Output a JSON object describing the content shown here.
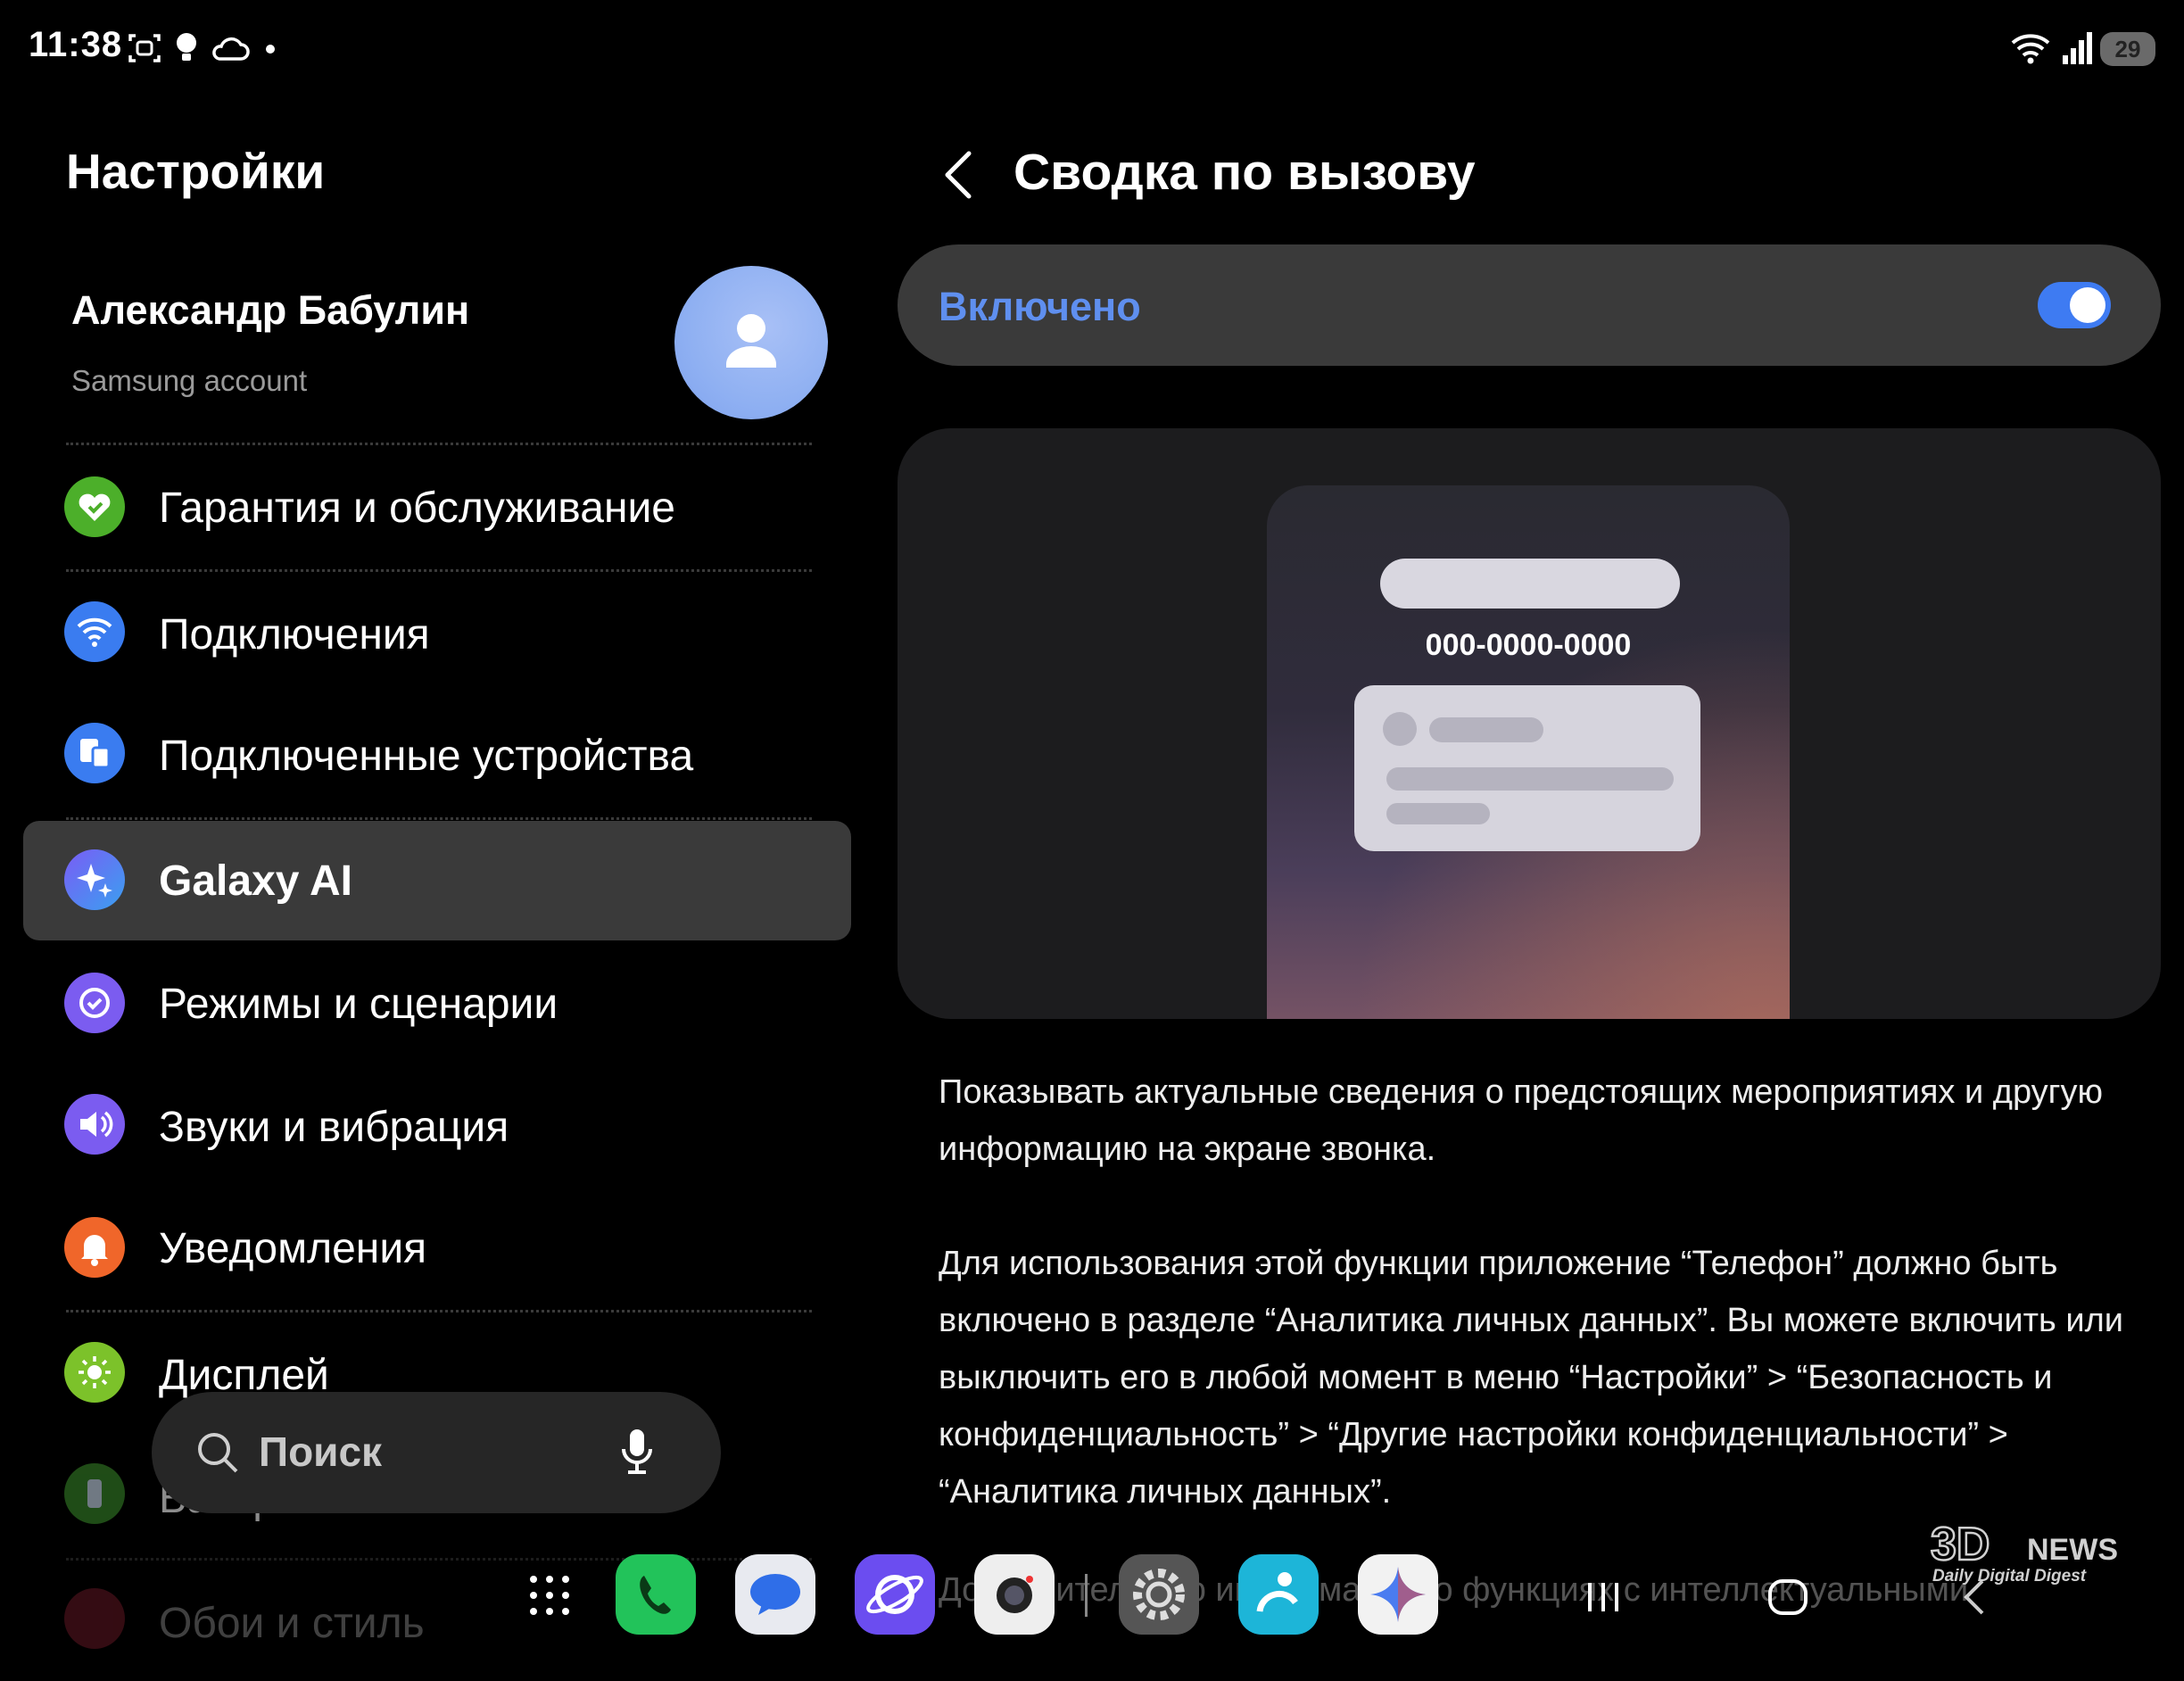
{
  "status_bar": {
    "time": "11:38",
    "left_icons": [
      "screenshot-icon",
      "bulb-icon",
      "cloud-icon",
      "dot-icon"
    ],
    "right_icons": [
      "wifi-icon",
      "signal-icon",
      "battery-icon"
    ],
    "battery_level": "29"
  },
  "sidebar": {
    "title": "Настройки",
    "account": {
      "name": "Александр Бабулин",
      "subtitle": "Samsung account",
      "icon": "person-icon"
    },
    "items": [
      {
        "label": "Гарантия и обслуживание",
        "icon": "heart-icon",
        "color": "#4caf2a"
      },
      {
        "label": "Подключения",
        "icon": "wifi-icon",
        "color": "#3a7cf0"
      },
      {
        "label": "Подключенные устройства",
        "icon": "devices-icon",
        "color": "#3a7cf0"
      },
      {
        "label": "Galaxy AI",
        "icon": "sparkle-icon",
        "color": "#4d6af5",
        "active": true
      },
      {
        "label": "Режимы и сценарии",
        "icon": "check-circle-icon",
        "color": "#7b5cf0"
      },
      {
        "label": "Звуки и вибрация",
        "icon": "speaker-icon",
        "color": "#7b5cf0"
      },
      {
        "label": "Уведомления",
        "icon": "bell-icon",
        "color": "#f0662a"
      },
      {
        "label": "Дисплей",
        "icon": "sun-icon",
        "color": "#7cc22a"
      },
      {
        "label": "Батарея",
        "icon": "battery-icon",
        "color": "#3a8a2a"
      },
      {
        "label": "Обои и стиль",
        "icon": "wallpaper-icon",
        "color": "#d0304a"
      }
    ]
  },
  "search": {
    "label": "Поиск",
    "icons": [
      "search-icon",
      "mic-icon"
    ]
  },
  "detail": {
    "title": "Сводка по вызову",
    "toggle": {
      "label": "Включено",
      "state": "on",
      "accent": "#3e7bf2"
    },
    "preview": {
      "number": "000-0000-0000"
    },
    "paragraph1": "Показывать актуальные сведения о предстоящих мероприятиях и другую информацию на экране звонка.",
    "paragraph2": "Для использования этой функции приложение “Телефон” должно быть включено в разделе “Аналитика личных данных”. Вы можете включить или выключить его в любой момент в меню “Настройки” > “Безопасность и конфиденциальность” > “Другие настройки конфиденциальности” > “Аналитика личных данных”.",
    "paragraph3": "Дополнительную информацию о функциях с интеллектуальными"
  },
  "dock": {
    "apps": [
      {
        "name": "apps-grid-icon"
      },
      {
        "name": "phone-app-icon",
        "color": "#22c35a"
      },
      {
        "name": "messages-app-icon",
        "color": "#e8eaf0"
      },
      {
        "name": "internet-app-icon",
        "color": "#6b4df0"
      },
      {
        "name": "camera-app-icon",
        "color": "#eeeeee"
      },
      {
        "name": "settings-app-icon",
        "color": "#555555"
      },
      {
        "name": "bixby-app-icon",
        "color": "#1db5d8"
      },
      {
        "name": "gemini-app-icon",
        "color": "#f2f2f2"
      }
    ],
    "nav": [
      "recents-icon",
      "home-icon",
      "back-nav-icon"
    ]
  },
  "watermark": {
    "brand": "3DNEWS",
    "tagline": "Daily Digital Digest"
  }
}
